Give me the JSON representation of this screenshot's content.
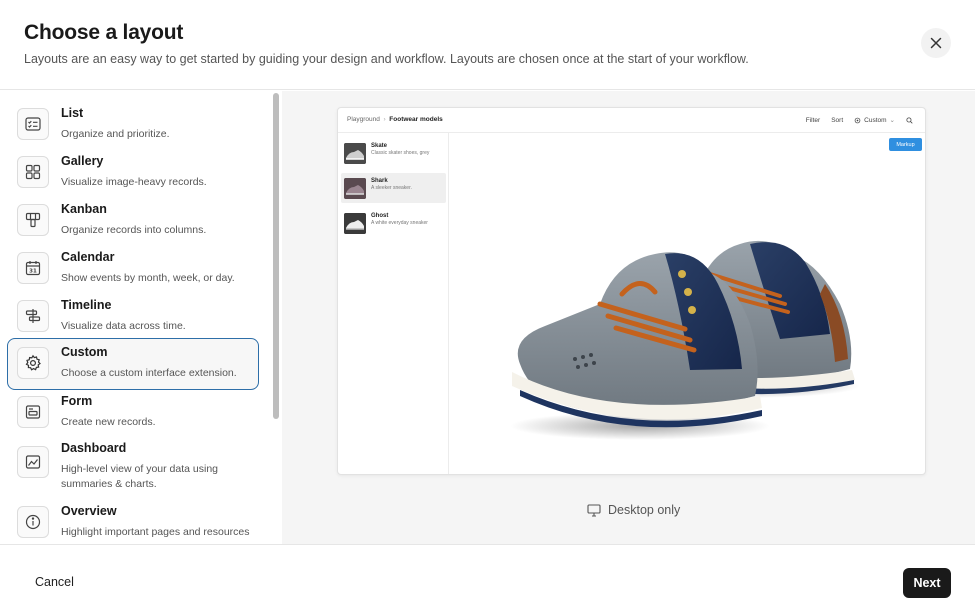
{
  "header": {
    "title": "Choose a layout",
    "subtitle": "Layouts are an easy way to get started by guiding your design and workflow. Layouts are chosen once at the start of your workflow."
  },
  "layouts": [
    {
      "label": "List",
      "description": "Organize and prioritize.",
      "icon": "list-icon"
    },
    {
      "label": "Gallery",
      "description": "Visualize image-heavy records.",
      "icon": "gallery-icon"
    },
    {
      "label": "Kanban",
      "description": "Organize records into columns.",
      "icon": "kanban-icon"
    },
    {
      "label": "Calendar",
      "description": "Show events by month, week, or day.",
      "icon": "calendar-icon"
    },
    {
      "label": "Timeline",
      "description": "Visualize data across time.",
      "icon": "timeline-icon"
    },
    {
      "label": "Custom",
      "description": "Choose a custom interface extension.",
      "icon": "gear-icon",
      "selected": true
    },
    {
      "label": "Form",
      "description": "Create new records.",
      "icon": "form-icon"
    },
    {
      "label": "Dashboard",
      "description": "High-level view of your data using summaries & charts.",
      "icon": "dashboard-icon"
    },
    {
      "label": "Overview",
      "description": "Highlight important pages and resources",
      "icon": "info-icon"
    }
  ],
  "preview": {
    "breadcrumb_parent": "Playground",
    "breadcrumb_current": "Footwear models",
    "filter": "Filter",
    "sort": "Sort",
    "custom": "Custom",
    "markup": "Markup",
    "records": [
      {
        "name": "Skate",
        "description": "Classic skater shoes, grey"
      },
      {
        "name": "Shark",
        "description": "A sleeker sneaker."
      },
      {
        "name": "Ghost",
        "description": "A white everyday sneaker"
      }
    ]
  },
  "desktop_only": "Desktop only",
  "footer": {
    "cancel": "Cancel",
    "next": "Next"
  },
  "colors": {
    "selected_border": "#2d6ea8",
    "markup_button": "#2f8fe0",
    "next_button": "#1a1a1a"
  }
}
